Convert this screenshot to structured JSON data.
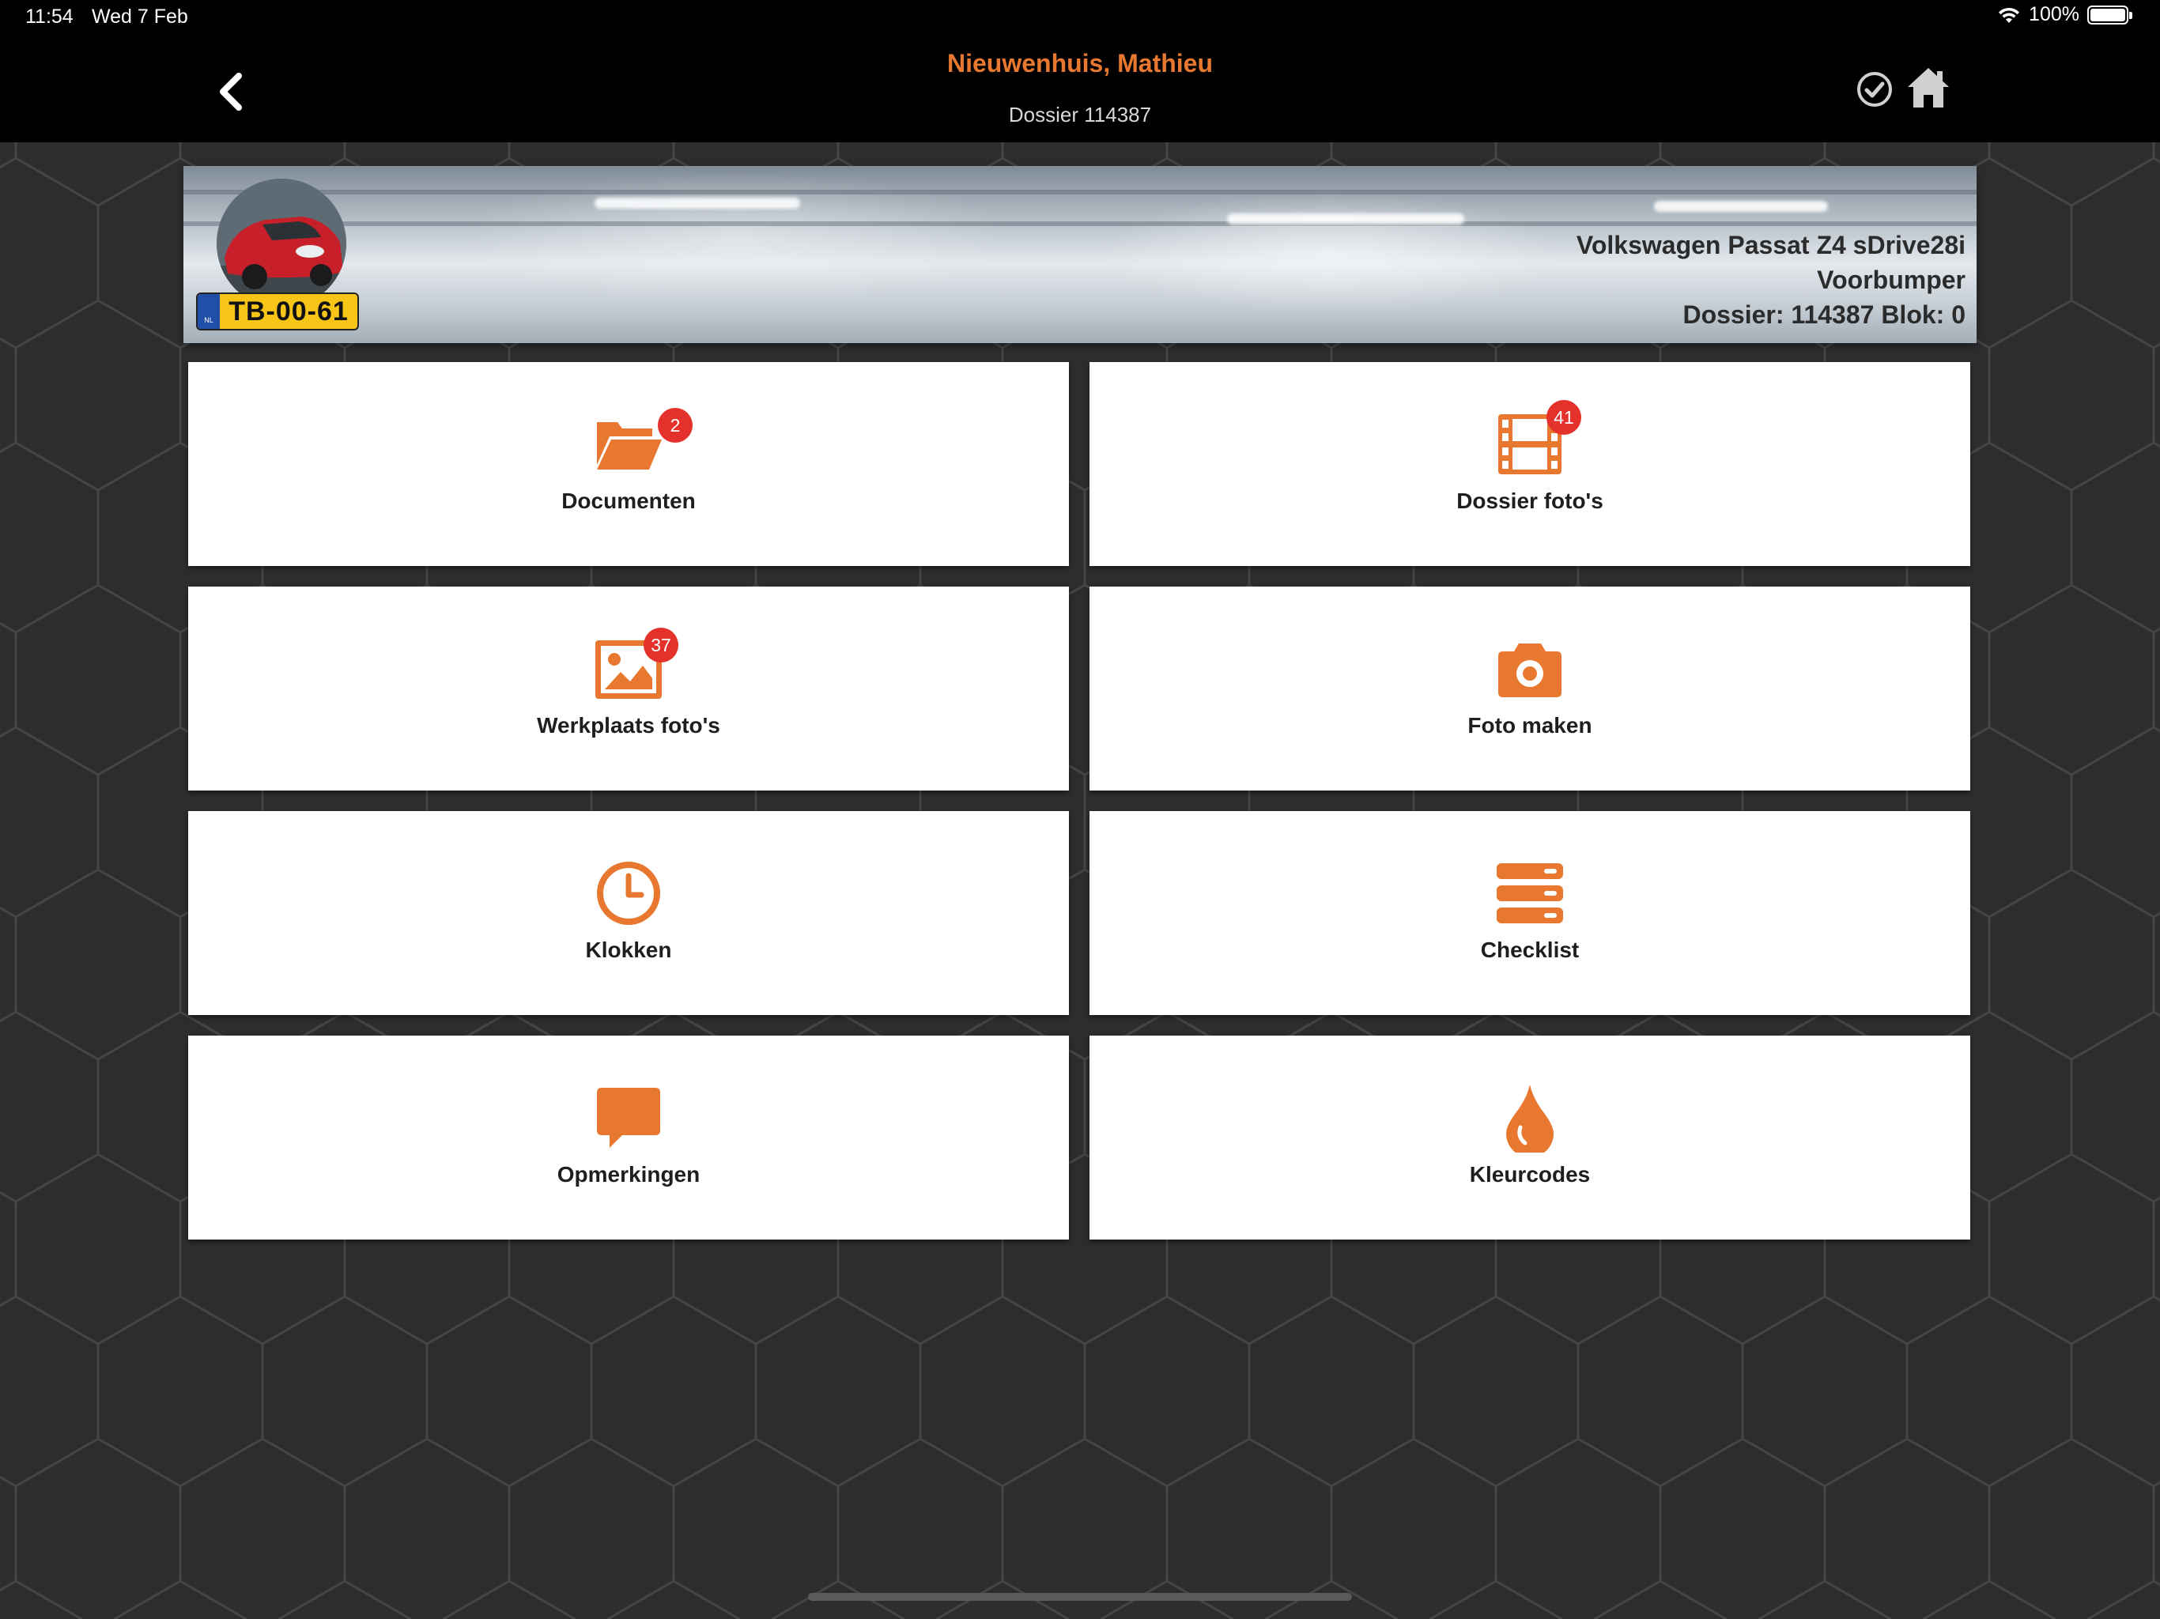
{
  "status_bar": {
    "time": "11:54",
    "date": "Wed 7 Feb",
    "battery": "100%"
  },
  "nav": {
    "title": "Nieuwenhuis, Mathieu",
    "subtitle": "Dossier 114387",
    "accent_color": "#e8782f"
  },
  "vehicle": {
    "plate_country": "NL",
    "plate": "TB-00-61",
    "model": "Volkswagen Passat Z4 sDrive28i",
    "part": "Voorbumper",
    "dossier_line": "Dossier: 114387 Blok: 0"
  },
  "tiles": [
    {
      "label": "Documenten",
      "icon": "folder-open-icon",
      "badge": "2"
    },
    {
      "label": "Dossier foto's",
      "icon": "film-icon",
      "badge": "41"
    },
    {
      "label": "Werkplaats foto's",
      "icon": "image-icon",
      "badge": "37"
    },
    {
      "label": "Foto maken",
      "icon": "camera-icon"
    },
    {
      "label": "Klokken",
      "icon": "clock-icon"
    },
    {
      "label": "Checklist",
      "icon": "list-icon"
    },
    {
      "label": "Opmerkingen",
      "icon": "comment-icon"
    },
    {
      "label": "Kleurcodes",
      "icon": "drop-icon"
    }
  ],
  "colors": {
    "icon": "#e8782f",
    "badge": "#e5312b",
    "tile_background": "#ffffff",
    "page_background": "#2d2d2f"
  }
}
